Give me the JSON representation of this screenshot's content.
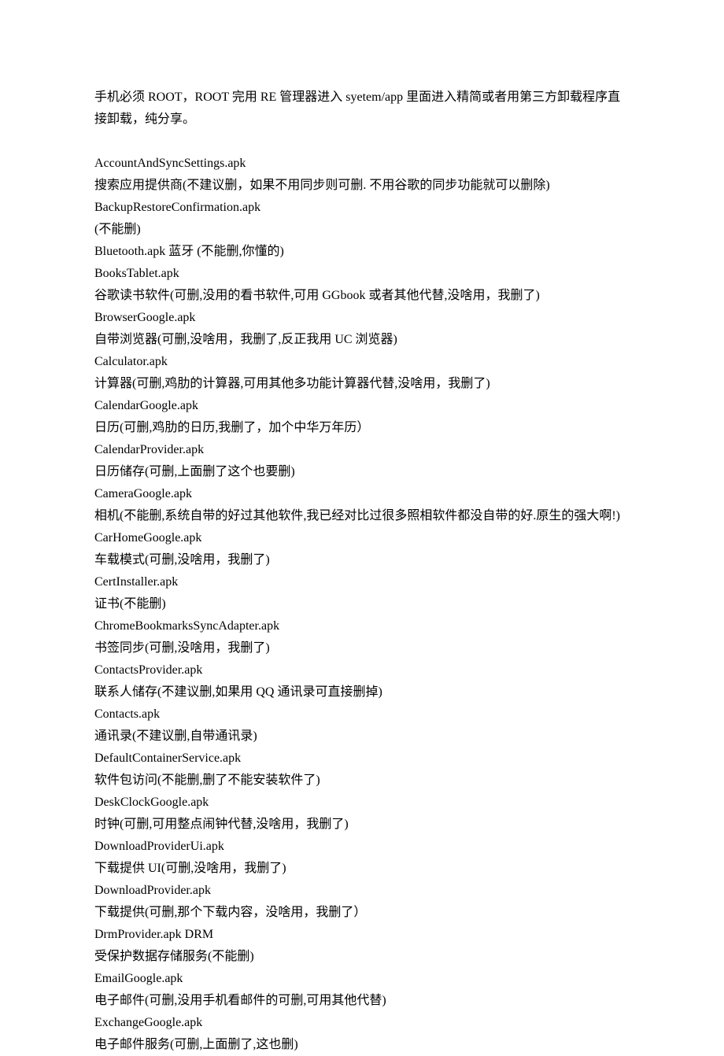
{
  "intro": "手机必须 ROOT，ROOT 完用 RE 管理器进入 syetem/app 里面进入精简或者用第三方卸载程序直接卸载，纯分享。",
  "lines": [
    "AccountAndSyncSettings.apk",
    "搜索应用提供商(不建议删，如果不用同步则可删. 不用谷歌的同步功能就可以删除)",
    "BackupRestoreConfirmation.apk",
    "(不能删)",
    "Bluetooth.apk  蓝牙  (不能删,你懂的)",
    "BooksTablet.apk",
    "谷歌读书软件(可删,没用的看书软件,可用 GGbook 或者其他代替,没啥用，我删了)",
    "BrowserGoogle.apk",
    "自带浏览器(可删,没啥用，我删了,反正我用 UC 浏览器)",
    "Calculator.apk",
    "计算器(可删,鸡肋的计算器,可用其他多功能计算器代替,没啥用，我删了)",
    "CalendarGoogle.apk",
    "日历(可删,鸡肋的日历,我删了，加个中华万年历）",
    "CalendarProvider.apk",
    "日历储存(可删,上面删了这个也要删)",
    "CameraGoogle.apk",
    "相机(不能删,系统自带的好过其他软件,我已经对比过很多照相软件都没自带的好.原生的强大啊!)",
    "CarHomeGoogle.apk",
    "车载模式(可删,没啥用，我删了)",
    "CertInstaller.apk",
    "证书(不能删)",
    "ChromeBookmarksSyncAdapter.apk",
    "书签同步(可删,没啥用，我删了)",
    "ContactsProvider.apk",
    "联系人储存(不建议删,如果用 QQ 通讯录可直接删掉)",
    "Contacts.apk",
    "通讯录(不建议删,自带通讯录)",
    "DefaultContainerService.apk",
    "软件包访问(不能删,删了不能安装软件了)",
    "DeskClockGoogle.apk",
    "时钟(可删,可用整点闹钟代替,没啥用，我删了)",
    "DownloadProviderUi.apk",
    "下载提供 UI(可删,没啥用，我删了)",
    "DownloadProvider.apk",
    "下载提供(可删,那个下载内容，没啥用，我删了）",
    "DrmProvider.apk DRM",
    "受保护数据存储服务(不能删)",
    "EmailGoogle.apk",
    "电子邮件(可删,没用手机看邮件的可删,可用其他代替)",
    "ExchangeGoogle.apk",
    "电子邮件服务(可删,上面删了,这也删)"
  ]
}
